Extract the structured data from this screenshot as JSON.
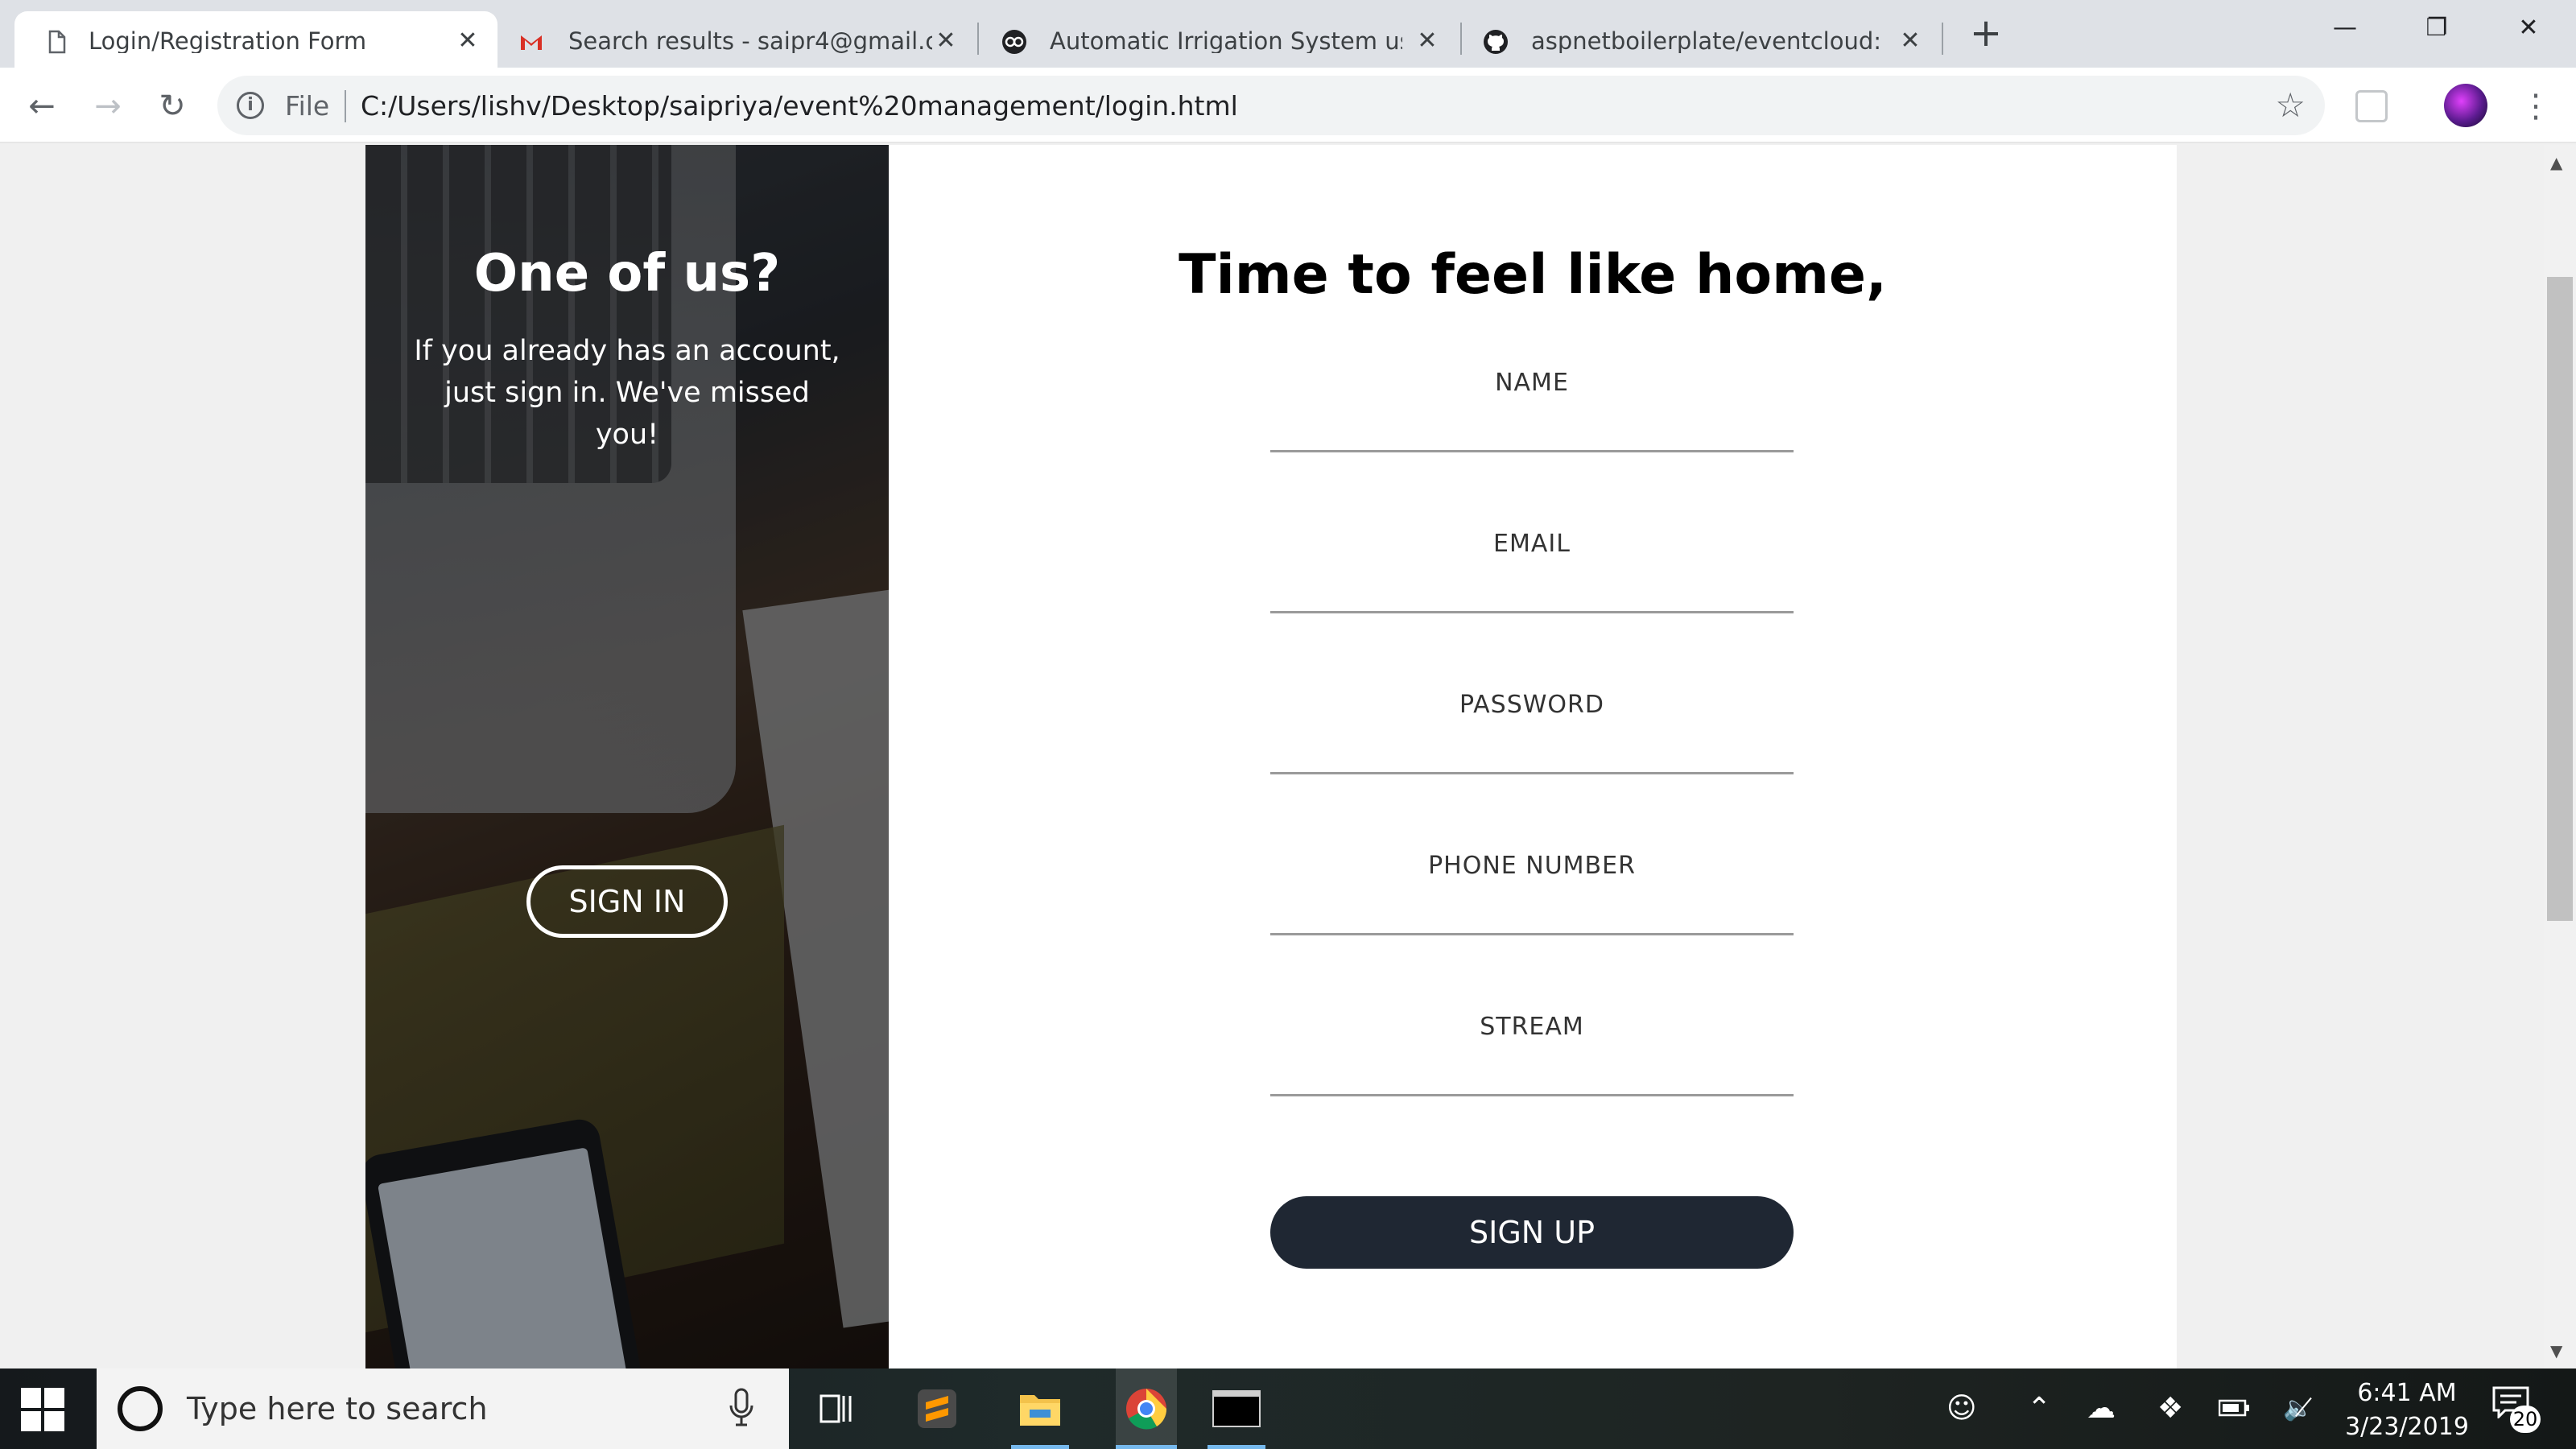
{
  "browser": {
    "tabs": [
      {
        "title": "Login/Registration Form",
        "favicon": "page-icon",
        "active": true
      },
      {
        "title": "Search results - saipr4@gmail.co",
        "favicon": "gmail-icon",
        "active": false
      },
      {
        "title": "Automatic Irrigation System usin",
        "favicon": "instructables-icon",
        "active": false
      },
      {
        "title": "aspnetboilerplate/eventcloud: Sa",
        "favicon": "github-icon",
        "active": false
      }
    ],
    "new_tab_glyph": "+",
    "window_controls": {
      "minimize": "—",
      "restore": "❐",
      "close": "✕"
    },
    "address": {
      "scheme": "File",
      "url": "C:/Users/lishv/Desktop/saipriya/event%20management/login.html"
    }
  },
  "page": {
    "signin_panel": {
      "title": "One of us?",
      "text": "If you already has an account, just sign in. We've missed you!",
      "button": "SIGN IN"
    },
    "signup_form": {
      "title": "Time to feel like home,",
      "fields": [
        {
          "label": "NAME",
          "value": ""
        },
        {
          "label": "EMAIL",
          "value": ""
        },
        {
          "label": "PASSWORD",
          "value": ""
        },
        {
          "label": "PHONE NUMBER",
          "value": ""
        },
        {
          "label": "STREAM",
          "value": ""
        }
      ],
      "button": "SIGN UP"
    }
  },
  "taskbar": {
    "search_placeholder": "Type here to search",
    "apps": [
      "task-view-icon",
      "sublime-text-icon",
      "file-explorer-icon",
      "chrome-icon",
      "terminal-icon"
    ],
    "clock": {
      "time": "6:41 AM",
      "date": "3/23/2019"
    },
    "notification_count": "20"
  },
  "colors": {
    "signup_button": "#1f2733",
    "tab_strip": "#dee1e6",
    "accent_underline": "#76b9ed"
  }
}
